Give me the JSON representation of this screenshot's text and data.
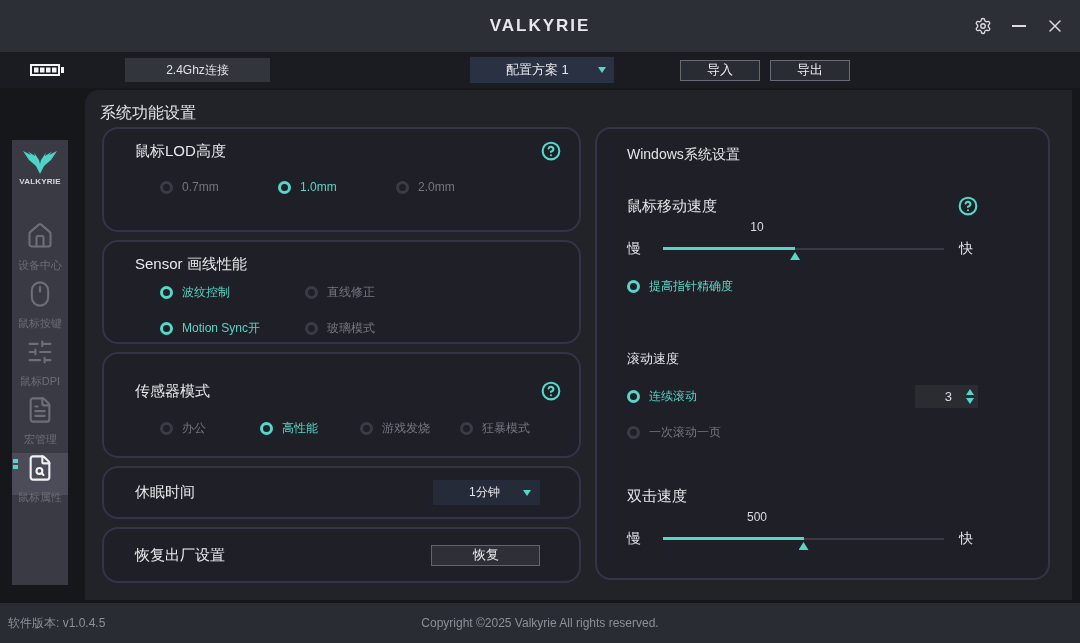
{
  "title_bar": {
    "logo": "VALKYRIE"
  },
  "toolbar": {
    "connection": "2.4Ghz连接",
    "profile": "配置方案 1",
    "buttons": [
      "导入",
      "导出"
    ]
  },
  "sidebar": {
    "logo_text": "VALKYRIE",
    "items": [
      {
        "label": "设备中心",
        "selected": false
      },
      {
        "label": "鼠标按键",
        "selected": false
      },
      {
        "label": "鼠标DPI",
        "selected": false
      },
      {
        "label": "宏管理",
        "selected": false
      },
      {
        "label": "鼠标属性",
        "selected": true
      }
    ]
  },
  "page_title": "系统功能设置",
  "cards": [
    {
      "kind": "radio",
      "title": "鼠标LOD高度",
      "help": true,
      "options": [
        {
          "label": "0.7mm",
          "selected": false
        },
        {
          "label": "1.0mm",
          "selected": true
        },
        {
          "label": "2.0mm",
          "selected": false
        }
      ]
    },
    {
      "kind": "checks",
      "title": "Sensor 画线性能",
      "options": [
        {
          "label": "波纹控制",
          "checked": true
        },
        {
          "label": "直线修正",
          "checked": false
        },
        {
          "label": "Motion Sync开",
          "checked": true
        },
        {
          "label": "玻璃模式",
          "checked": false
        }
      ]
    },
    {
      "kind": "radio",
      "title": "传感器模式",
      "help": true,
      "options": [
        {
          "label": "办公",
          "selected": false
        },
        {
          "label": "高性能",
          "selected": true
        },
        {
          "label": "游戏发烧",
          "selected": false
        },
        {
          "label": "狂暴模式",
          "selected": false
        }
      ]
    },
    {
      "kind": "dropdown",
      "title": "休眠时间",
      "value": "1分钟"
    },
    {
      "kind": "button",
      "title": "恢复出厂设置",
      "button": "恢复"
    }
  ],
  "windows_settings": {
    "title": "Windows系统设置",
    "pointer_speed": {
      "label": "鼠标移动速度",
      "help": true,
      "value": "10",
      "slow": "慢",
      "fast": "快",
      "level": 0.47
    },
    "precision": {
      "label": "提高指针精确度",
      "checked": true
    },
    "scroll": {
      "label": "滚动速度",
      "options": [
        {
          "label": "连续滚动",
          "selected": true
        },
        {
          "label": "一次滚动一页",
          "selected": false
        }
      ],
      "lines": "3"
    },
    "double_click": {
      "label": "双击速度",
      "value": "500",
      "slow": "慢",
      "fast": "快",
      "level": 0.5
    }
  },
  "status_bar": {
    "version": "软件版本: v1.0.4.5",
    "copyright": "Copyright ©2025 Valkyrie All rights reserved."
  }
}
